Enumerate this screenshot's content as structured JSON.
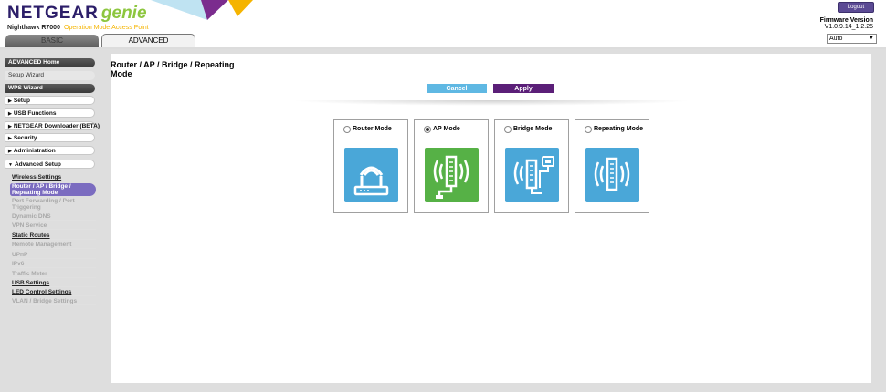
{
  "header": {
    "brand": "NETGEAR",
    "brand_suffix": "genie",
    "model": "Nighthawk R7000",
    "operation_mode": "Operation Mode:Access Point",
    "logout_label": "Logout",
    "firmware_label": "Firmware Version",
    "firmware_value": "V1.0.9.14_1.2.25",
    "language": "Auto"
  },
  "tabs": {
    "basic": "BASIC",
    "advanced": "ADVANCED"
  },
  "sidebar": {
    "advanced_home": "ADVANCED Home",
    "setup_wizard": "Setup Wizard",
    "wps_wizard": "WPS Wizard",
    "sections": [
      {
        "label": "Setup",
        "state": "collapsed"
      },
      {
        "label": "USB Functions",
        "state": "collapsed"
      },
      {
        "label": "NETGEAR Downloader (BETA)",
        "state": "collapsed"
      },
      {
        "label": "Security",
        "state": "collapsed"
      },
      {
        "label": "Administration",
        "state": "collapsed"
      },
      {
        "label": "Advanced Setup",
        "state": "expanded"
      }
    ],
    "advanced_setup_items": [
      {
        "label": "Wireless Settings",
        "state": "link"
      },
      {
        "label": "Router / AP / Bridge / Repeating Mode",
        "state": "active"
      },
      {
        "label": "Port Forwarding / Port Triggering",
        "state": "disabled"
      },
      {
        "label": "Dynamic DNS",
        "state": "disabled"
      },
      {
        "label": "VPN Service",
        "state": "disabled"
      },
      {
        "label": "Static Routes",
        "state": "link"
      },
      {
        "label": "Remote Management",
        "state": "disabled"
      },
      {
        "label": "UPnP",
        "state": "disabled"
      },
      {
        "label": "IPv6",
        "state": "disabled"
      },
      {
        "label": "Traffic Meter",
        "state": "disabled"
      },
      {
        "label": "USB Settings",
        "state": "link"
      },
      {
        "label": "LED Control Settings",
        "state": "link"
      },
      {
        "label": "VLAN / Bridge Settings",
        "state": "disabled"
      }
    ]
  },
  "main": {
    "title": "Router / AP / Bridge / Repeating Mode",
    "cancel_label": "Cancel",
    "apply_label": "Apply",
    "modes": [
      {
        "label": "Router Mode",
        "selected": false,
        "icon": "router-icon",
        "color": "#4aa7d8"
      },
      {
        "label": "AP Mode",
        "selected": true,
        "icon": "access-point-icon",
        "color": "#56b146"
      },
      {
        "label": "Bridge Mode",
        "selected": false,
        "icon": "bridge-icon",
        "color": "#4aa7d8"
      },
      {
        "label": "Repeating Mode",
        "selected": false,
        "icon": "repeater-icon",
        "color": "#4aa7d8"
      }
    ]
  },
  "colors": {
    "brand_purple": "#2c1e69",
    "genie_green": "#8dc63f",
    "active_item": "#7b6cc0",
    "cancel_button": "#5fb8e3",
    "apply_button": "#5b1f78"
  }
}
